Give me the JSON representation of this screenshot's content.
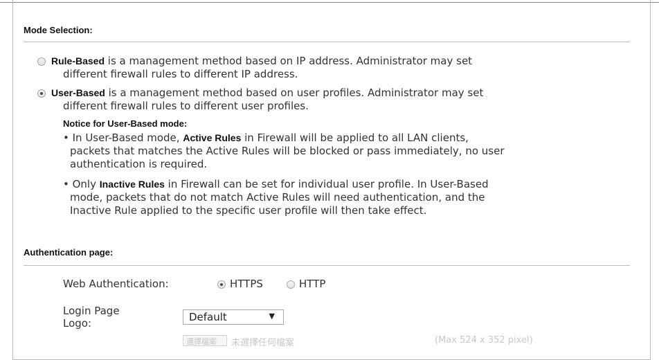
{
  "mode_selection": {
    "title": "Mode Selection:",
    "rule_based": {
      "bold": "Rule-Based",
      "line1": " is a management method based on IP address. Administrator may set",
      "line2": "different firewall rules to different IP address.",
      "checked": false
    },
    "user_based": {
      "bold": "User-Based",
      "line1": " is a management method based on user profiles. Administrator may set",
      "line2": "different firewall rules to different user profiles.",
      "checked": true
    },
    "notice": {
      "title": "Notice for User-Based mode:",
      "bullet1": {
        "pre": "• In User-Based mode, ",
        "bold": "Active Rules",
        "post": " in Firewall will be applied to all LAN clients,",
        "line2": "packets that matches the Active Rules will be blocked or pass immediately, no user",
        "line3": "authentication is required."
      },
      "bullet2": {
        "pre": "• Only ",
        "bold": "Inactive Rules",
        "post": " in Firewall can be set for individual user profile. In User-Based",
        "line2": "mode, packets that do not match Active Rules will need authentication, and the",
        "line3": "Inactive Rule applied to the specific user profile will then take effect."
      }
    }
  },
  "authentication_page": {
    "title": "Authentication page:",
    "web_auth_label": "Web Authentication:",
    "https_label": "HTTPS",
    "https_checked": true,
    "http_label": "HTTP",
    "http_checked": false,
    "login_logo_label_line1": "Login Page",
    "login_logo_label_line2": "Logo:",
    "login_logo_value": "Default",
    "dropdown_arrow": "▼",
    "partial_button": "選擇檔案",
    "partial_file_text": "未選擇任何檔案",
    "partial_hint": "(Max 524 x 352 pixel)"
  }
}
